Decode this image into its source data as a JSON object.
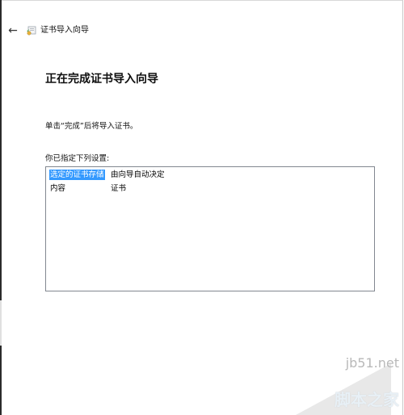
{
  "window": {
    "title": "证书导入向导",
    "back_glyph": "←"
  },
  "wizard": {
    "heading": "正在完成证书导入向导",
    "info": "单击“完成”后将导入证书。",
    "settings_label": "你已指定下列设置:",
    "settings": [
      {
        "key": "选定的证书存储",
        "value": "由向导自动决定"
      },
      {
        "key": "内容",
        "value": "证书"
      }
    ]
  },
  "watermark": {
    "url": "jb51.net",
    "brand": "脚本之家"
  }
}
